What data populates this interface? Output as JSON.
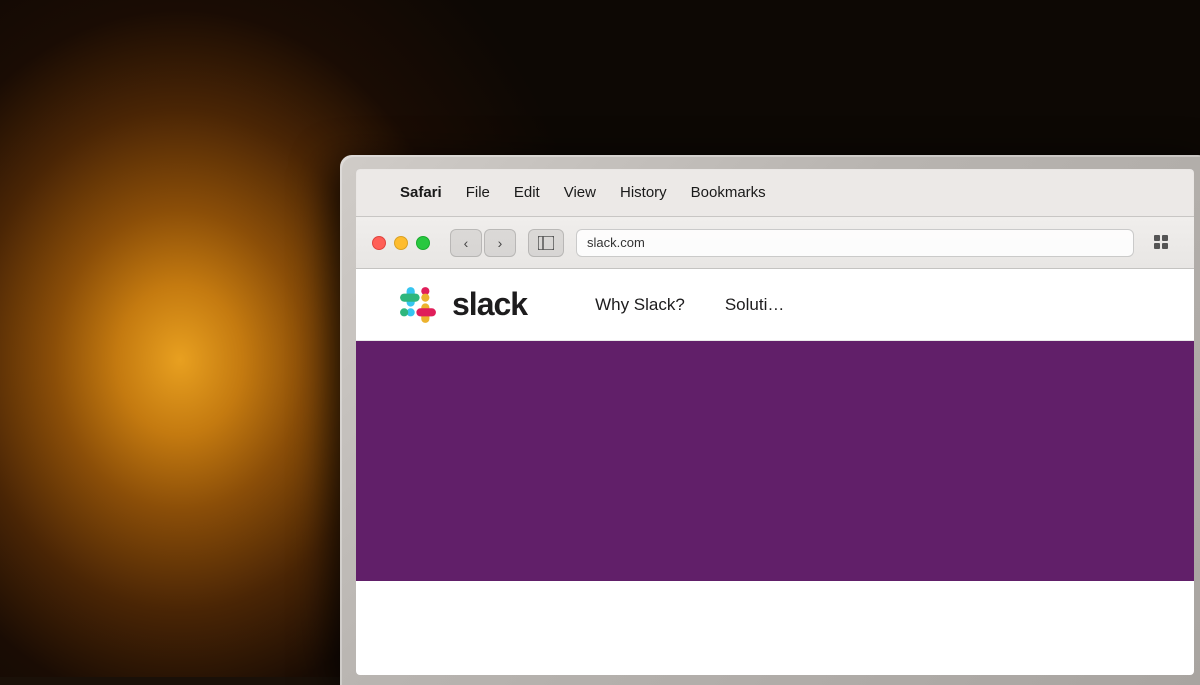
{
  "background": {
    "color_left": "#e8a020",
    "color_right": "#1a0c04"
  },
  "menubar": {
    "apple_symbol": "",
    "app_name": "Safari",
    "items": [
      "File",
      "Edit",
      "View",
      "History",
      "Bookmarks"
    ]
  },
  "toolbar": {
    "back_label": "‹",
    "forward_label": "›",
    "sidebar_label": "⊟",
    "grid_label": "⊞"
  },
  "slack_nav": {
    "wordmark": "slack",
    "nav_items": [
      "Why Slack?",
      "Soluti…"
    ]
  },
  "slack_hero": {
    "background_color": "#611f69"
  }
}
